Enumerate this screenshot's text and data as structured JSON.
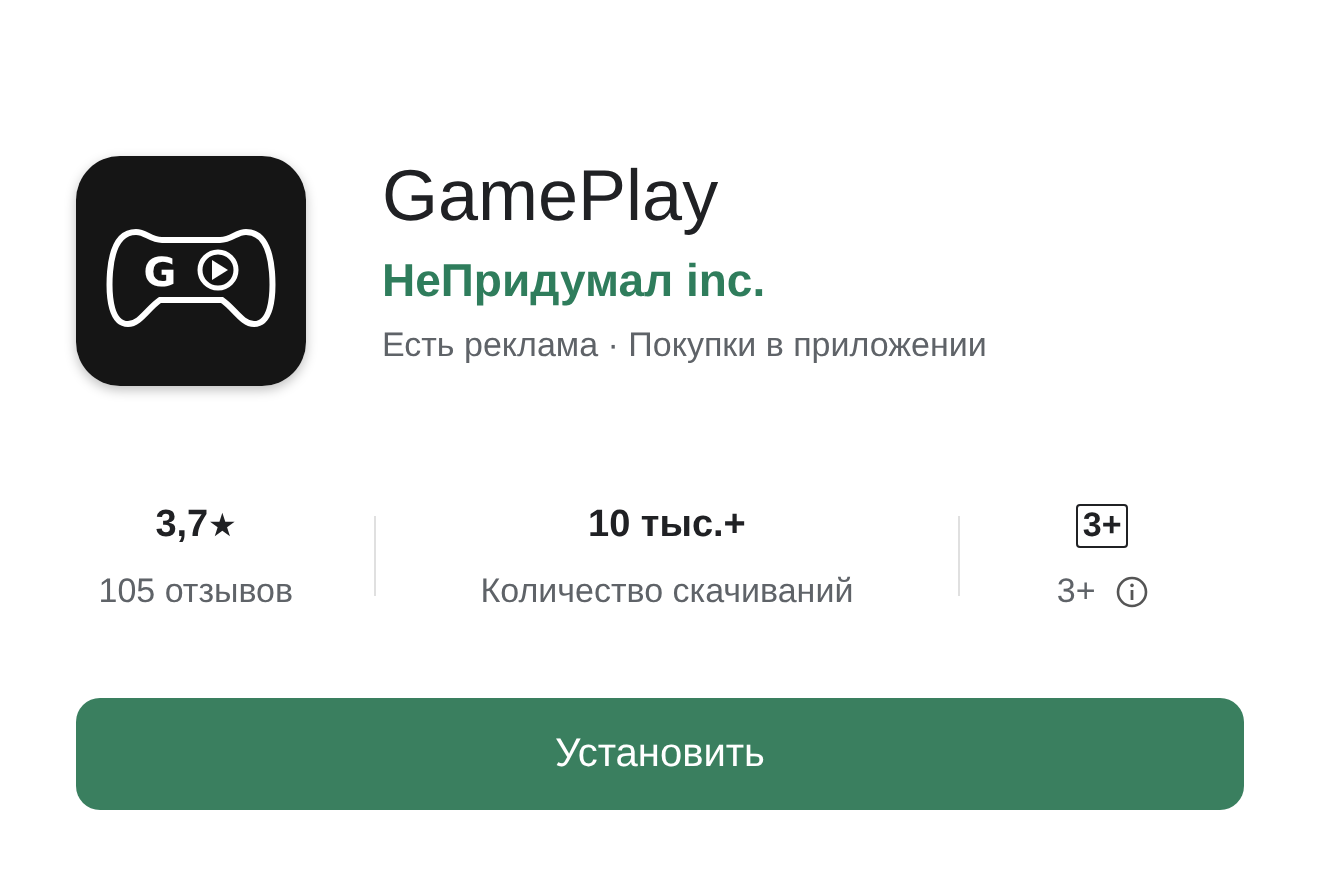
{
  "app": {
    "icon_letter": "G",
    "title": "GamePlay",
    "developer": "НеПридумал inc.",
    "meta": "Есть реклама · Покупки в приложении"
  },
  "stats": [
    {
      "kind": "rating",
      "value": "3,7",
      "star": "★",
      "label": "105 отзывов"
    },
    {
      "kind": "downloads",
      "value": "10 тыс.+",
      "label": "Количество скачиваний"
    },
    {
      "kind": "age",
      "badge": "3+",
      "label": "3+"
    }
  ],
  "install_button": {
    "label": "Установить"
  }
}
